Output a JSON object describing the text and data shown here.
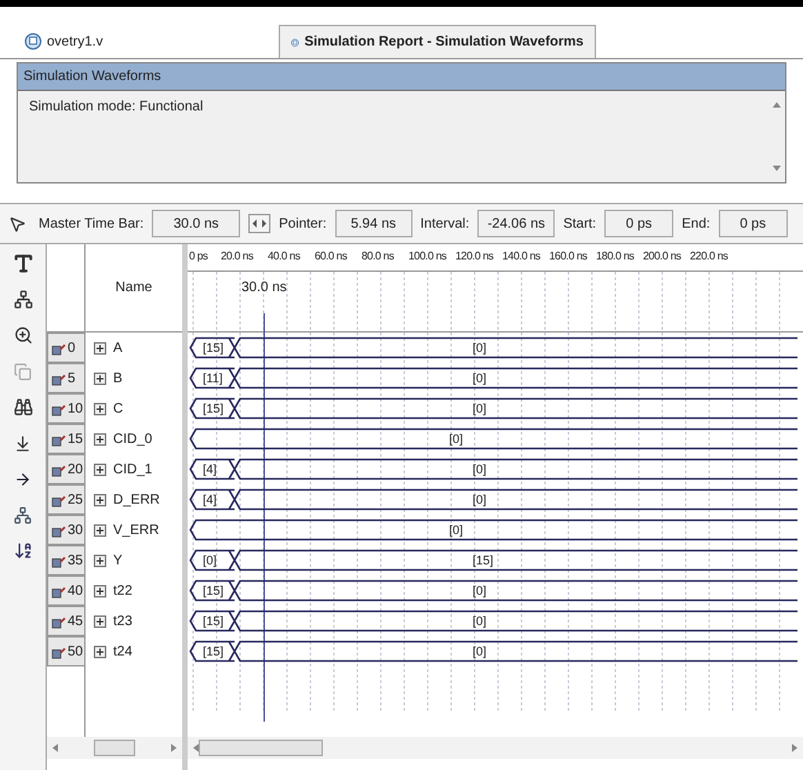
{
  "tabs": [
    {
      "label": "ovetry1.v",
      "selected": false
    },
    {
      "label": "Simulation Report - Simulation Waveforms",
      "selected": true
    }
  ],
  "panel": {
    "title": "Simulation Waveforms",
    "text": "Simulation mode: Functional"
  },
  "toolbar": {
    "fields": [
      {
        "label": "Master Time Bar:",
        "value": "30.0 ns"
      },
      {
        "label": "Pointer:",
        "value": "5.94 ns"
      },
      {
        "label": "Interval:",
        "value": "-24.06 ns"
      },
      {
        "label": "Start:",
        "value": "0 ps"
      },
      {
        "label": "End:",
        "value": "0 ps"
      }
    ]
  },
  "waveform": {
    "name_header": "Name",
    "cursor_label": "30.0 ns",
    "ticks": [
      "0 ps",
      "20.0 ns",
      "40.0 ns",
      "60.0 ns",
      "80.0 ns",
      "100.0 ns",
      "120.0 ns",
      "140.0 ns",
      "160.0 ns",
      "180.0 ns",
      "200.0 ns",
      "220.0 ns"
    ],
    "signals": [
      {
        "index": "0",
        "name": "A",
        "segments": [
          "[15]",
          "[0]"
        ]
      },
      {
        "index": "5",
        "name": "B",
        "segments": [
          "[11]",
          "[0]"
        ]
      },
      {
        "index": "10",
        "name": "C",
        "segments": [
          "[15]",
          "[0]"
        ]
      },
      {
        "index": "15",
        "name": "CID_0",
        "segments": [
          "[0]"
        ]
      },
      {
        "index": "20",
        "name": "CID_1",
        "segments": [
          "[4]",
          "[0]"
        ]
      },
      {
        "index": "25",
        "name": "D_ERR",
        "segments": [
          "[4]",
          "[0]"
        ]
      },
      {
        "index": "30",
        "name": "V_ERR",
        "segments": [
          "[0]"
        ]
      },
      {
        "index": "35",
        "name": "Y",
        "segments": [
          "[0]",
          "[15]"
        ]
      },
      {
        "index": "40",
        "name": "t22",
        "segments": [
          "[15]",
          "[0]"
        ]
      },
      {
        "index": "45",
        "name": "t23",
        "segments": [
          "[15]",
          "[0]"
        ]
      },
      {
        "index": "50",
        "name": "t24",
        "segments": [
          "[15]",
          "[0]"
        ]
      }
    ]
  }
}
